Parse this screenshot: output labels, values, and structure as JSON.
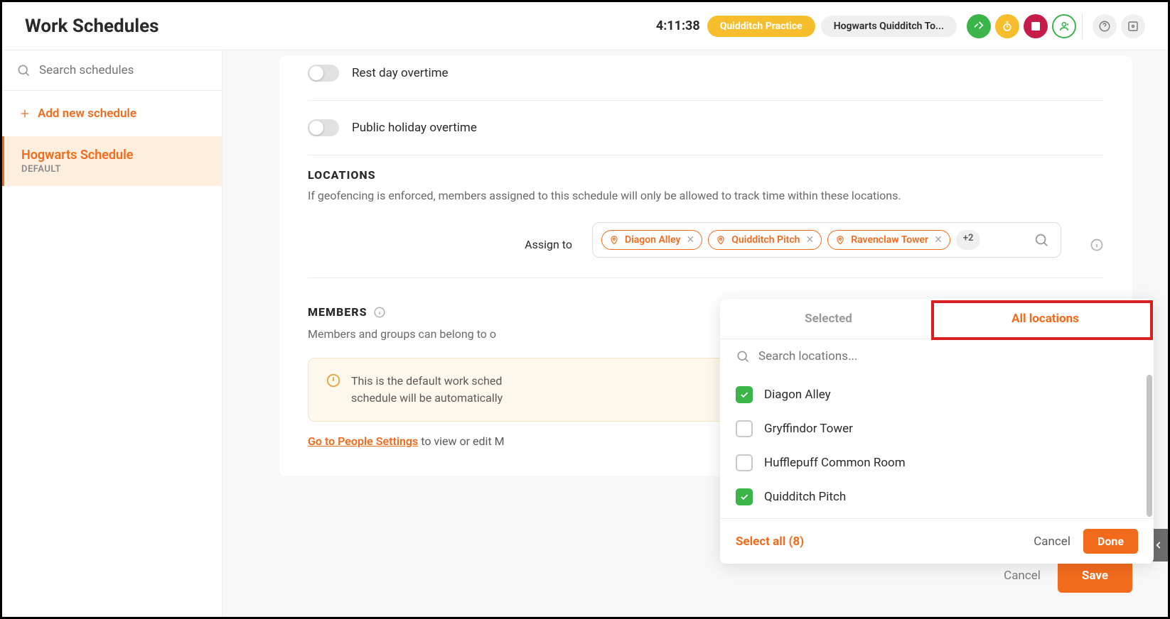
{
  "header": {
    "title": "Work Schedules",
    "timer": "4:11:38",
    "pill1": "Quidditch Practice",
    "pill2": "Hogwarts Quidditch To..."
  },
  "sidebar": {
    "search_placeholder": "Search schedules",
    "add_new": "Add new schedule",
    "schedule": {
      "name": "Hogwarts Schedule",
      "tag": "DEFAULT"
    }
  },
  "toggles": {
    "rest_day": "Rest day overtime",
    "public_holiday": "Public holiday overtime"
  },
  "locations": {
    "title": "LOCATIONS",
    "sub": "If geofencing is enforced, members assigned to this schedule will only be allowed to track time within these locations.",
    "assign_label": "Assign to",
    "chips": [
      "Diagon Alley",
      "Quidditch Pitch",
      "Ravenclaw Tower"
    ],
    "more": "+2"
  },
  "members": {
    "title": "MEMBERS",
    "sub": "Members and groups can belong to o",
    "warn1": "This is the default work sched",
    "warn2": "schedule will be automatically",
    "link": "Go to People Settings",
    "link_after": " to view or edit M"
  },
  "dropdown": {
    "tab_selected": "Selected",
    "tab_all": "All locations",
    "search_placeholder": "Search locations...",
    "items": [
      {
        "label": "Diagon Alley",
        "checked": true
      },
      {
        "label": "Gryffindor Tower",
        "checked": false
      },
      {
        "label": "Hufflepuff Common Room",
        "checked": false
      },
      {
        "label": "Quidditch Pitch",
        "checked": true
      }
    ],
    "select_all": "Select all (8)",
    "cancel": "Cancel",
    "done": "Done"
  },
  "footer": {
    "cancel": "Cancel",
    "save": "Save"
  }
}
